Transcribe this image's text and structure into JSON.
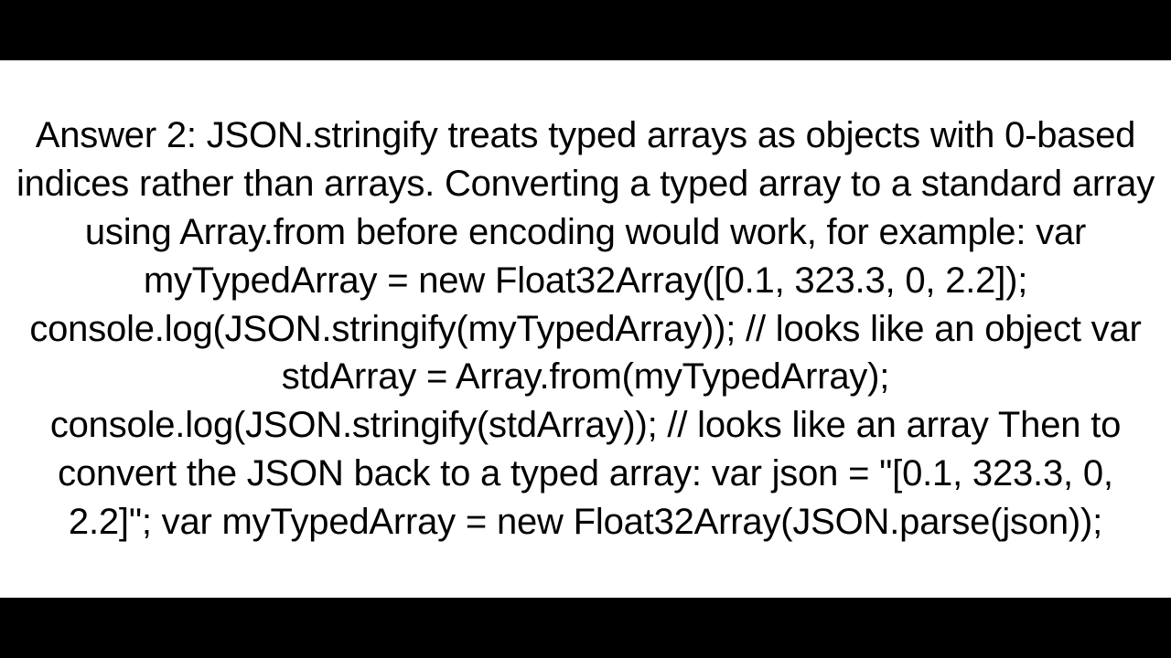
{
  "answer": {
    "text": "Answer 2: JSON.stringify treats typed arrays as objects with 0-based indices rather than arrays.  Converting a typed array to a standard array using Array.from before encoding would work, for example: var myTypedArray = new Float32Array([0.1, 323.3, 0, 2.2]); console.log(JSON.stringify(myTypedArray)); // looks like an object var stdArray = Array.from(myTypedArray); console.log(JSON.stringify(stdArray)); // looks like an array  Then to convert the JSON back to a typed array: var json = \"[0.1, 323.3, 0, 2.2]\"; var myTypedArray = new Float32Array(JSON.parse(json));"
  }
}
